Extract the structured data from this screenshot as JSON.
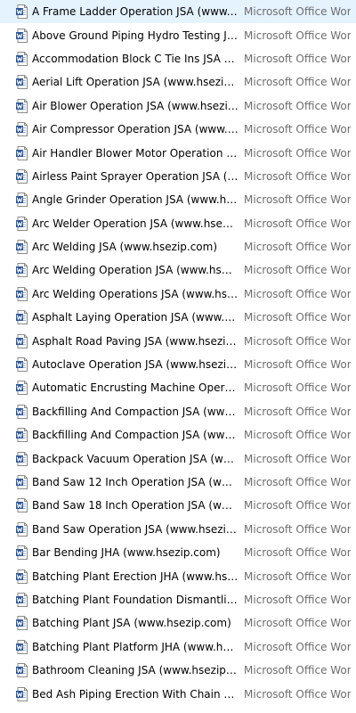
{
  "colors": {
    "icon_blue": "#2b579a",
    "icon_page": "#ffffff",
    "type_text": "#6d6d6d"
  },
  "files": [
    {
      "name": "A Frame Ladder Operation JSA (www.hsezip.com)",
      "type": "Microsoft Office Word Document",
      "icon": "word-document-icon"
    },
    {
      "name": "Above Ground Piping Hydro Testing JSA (www.hsezip.com)",
      "type": "Microsoft Office Word Document",
      "icon": "word-document-icon"
    },
    {
      "name": "Accommodation Block C Tie Ins JSA (www.hsezip.com)",
      "type": "Microsoft Office Word Document",
      "icon": "word-document-icon"
    },
    {
      "name": "Aerial Lift Operation JSA (www.hsezip.com)",
      "type": "Microsoft Office Word Document",
      "icon": "word-document-icon"
    },
    {
      "name": "Air Blower Operation JSA (www.hsezip.com)",
      "type": "Microsoft Office Word Document",
      "icon": "word-document-icon"
    },
    {
      "name": "Air Compressor Operation JSA (www.hsezip.com)",
      "type": "Microsoft Office Word Document",
      "icon": "word-document-icon"
    },
    {
      "name": "Air Handler Blower Motor Operation JSA (www.hsezip.com)",
      "type": "Microsoft Office Word Document",
      "icon": "word-document-icon"
    },
    {
      "name": "Airless Paint Sprayer Operation JSA (www.hsezip.com)",
      "type": "Microsoft Office Word Document",
      "icon": "word-document-icon"
    },
    {
      "name": "Angle Grinder Operation JSA (www.hsezip.com)",
      "type": "Microsoft Office Word Document",
      "icon": "word-document-icon"
    },
    {
      "name": "Arc Welder Operation JSA (www.hsezip.com)",
      "type": "Microsoft Office Word Document",
      "icon": "word-document-icon"
    },
    {
      "name": "Arc Welding JSA (www.hsezip.com)",
      "type": "Microsoft Office Word Document",
      "icon": "word-document-icon"
    },
    {
      "name": "Arc Welding Operation JSA (www.hsezip.com)",
      "type": "Microsoft Office Word Document",
      "icon": "word-document-icon"
    },
    {
      "name": "Arc Welding Operations JSA (www.hsezip.com)",
      "type": "Microsoft Office Word Document",
      "icon": "word-document-icon"
    },
    {
      "name": "Asphalt Laying Operation JSA (www.hsezip.com)",
      "type": "Microsoft Office Word Document",
      "icon": "word-document-icon"
    },
    {
      "name": "Asphalt Road Paving JSA (www.hsezip.com)",
      "type": "Microsoft Office Word Document",
      "icon": "word-document-icon"
    },
    {
      "name": "Autoclave Operation JSA (www.hsezip.com)",
      "type": "Microsoft Office Word Document",
      "icon": "word-document-icon"
    },
    {
      "name": "Automatic Encrusting Machine Operation JSA (www.hsezip.com)",
      "type": "Microsoft Office Word Document",
      "icon": "word-document-icon"
    },
    {
      "name": "Backfilling And Compaction JSA (www.hsezip.com)",
      "type": "Microsoft Office Word Document",
      "icon": "word-document-icon"
    },
    {
      "name": "Backfilling And Compaction JSA (www.hsezip.com)",
      "type": "Microsoft Office Word Document",
      "icon": "word-document-icon"
    },
    {
      "name": "Backpack Vacuum Operation JSA (www.hsezip.com)",
      "type": "Microsoft Office Word Document",
      "icon": "word-document-icon"
    },
    {
      "name": "Band Saw 12 Inch Operation JSA (www.hsezip.com)",
      "type": "Microsoft Office Word Document",
      "icon": "word-document-icon"
    },
    {
      "name": "Band Saw 18 Inch Operation JSA (www.hsezip.com)",
      "type": "Microsoft Office Word Document",
      "icon": "word-document-icon"
    },
    {
      "name": "Band Saw Operation JSA (www.hsezip.com)",
      "type": "Microsoft Office Word Document",
      "icon": "word-document-icon"
    },
    {
      "name": "Bar Bending JHA (www.hsezip.com)",
      "type": "Microsoft Office Word Document",
      "icon": "word-document-icon"
    },
    {
      "name": "Batching Plant Erection JHA (www.hsezip.com)",
      "type": "Microsoft Office Word Document",
      "icon": "word-document-icon"
    },
    {
      "name": "Batching Plant Foundation Dismantling JSA (www.hsezip.com)",
      "type": "Microsoft Office Word Document",
      "icon": "word-document-icon"
    },
    {
      "name": "Batching Plant JSA (www.hsezip.com)",
      "type": "Microsoft Office Word Document",
      "icon": "word-document-icon"
    },
    {
      "name": "Batching Plant Platform JHA (www.hsezip.com)",
      "type": "Microsoft Office Word Document",
      "icon": "word-document-icon"
    },
    {
      "name": "Bathroom Cleaning JSA (www.hsezip.com)",
      "type": "Microsoft Office Word Document",
      "icon": "word-document-icon"
    },
    {
      "name": "Bed Ash Piping Erection With Chain Pulley JSA (www.hsezip.com)",
      "type": "Microsoft Office Word Document",
      "icon": "word-document-icon"
    }
  ]
}
